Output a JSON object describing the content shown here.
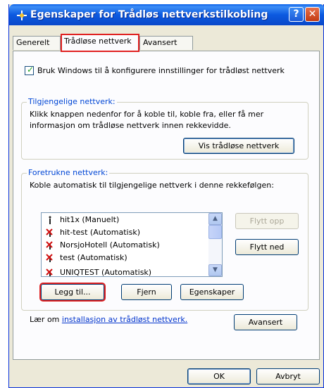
{
  "window": {
    "title": "Egenskaper for Trådløs nettverkstilkobling",
    "help_label": "?",
    "close_label": "✕"
  },
  "tabs": [
    {
      "label": "Generelt",
      "active": false
    },
    {
      "label": "Trådløse nettverk",
      "active": true
    },
    {
      "label": "Avansert",
      "active": false
    }
  ],
  "use_windows": {
    "checked": true,
    "label": "Bruk Windows til å konfigurere innstillinger for trådløst nettverk"
  },
  "available": {
    "legend": "Tilgjengelige nettverk:",
    "description_line1": "Klikk knappen nedenfor for å koble til, koble fra, eller få mer",
    "description_line2": "informasjon om trådløse nettverk innen rekkevidde.",
    "view_button": "Vis trådløse nettverk"
  },
  "preferred": {
    "legend": "Foretrukne nettverk:",
    "description": "Koble automatisk til tilgjengelige nettverk i denne rekkefølgen:",
    "networks": [
      {
        "label": "hit1x (Manuelt)",
        "icon": "antenna-icon"
      },
      {
        "label": "hit-test (Automatisk)",
        "icon": "antenna-x-icon"
      },
      {
        "label": "NorsjoHotell (Automatisk)",
        "icon": "antenna-x-icon"
      },
      {
        "label": "test (Automatisk)",
        "icon": "antenna-x-icon"
      },
      {
        "label": "UNIQTEST (Automatisk)",
        "icon": "antenna-x-icon"
      }
    ],
    "move_up": "Flytt opp",
    "move_down": "Flytt ned",
    "add": "Legg til...",
    "remove": "Fjern",
    "properties": "Egenskaper"
  },
  "learn": {
    "prefix": "Lær om ",
    "link": "installasjon av trådløst nettverk."
  },
  "advanced_button": "Avansert",
  "ok_button": "OK",
  "cancel_button": "Avbryt"
}
